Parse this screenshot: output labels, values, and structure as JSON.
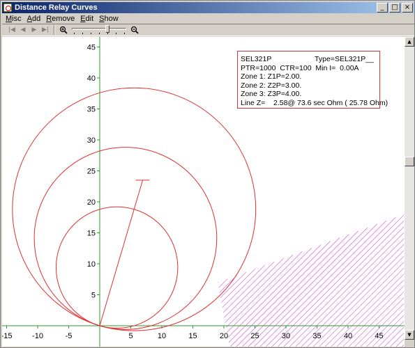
{
  "window": {
    "title": "Distance Relay Curves"
  },
  "caption_buttons": {
    "minimize": "_",
    "maximize": "□",
    "close": "×"
  },
  "menu": [
    {
      "u": "M",
      "rest": "isc"
    },
    {
      "u": "A",
      "rest": "dd"
    },
    {
      "u": "R",
      "rest": "emove"
    },
    {
      "u": "E",
      "rest": "dit"
    },
    {
      "u": "S",
      "rest": "how"
    }
  ],
  "toolbar": {
    "first_icon": "|◀",
    "prev_icon": "◀",
    "next_icon": "▶",
    "last_icon": "▶|",
    "zoom_in_icon": "+",
    "zoom_out_icon": "−",
    "zoom_level": 0.66
  },
  "plot": {
    "x_ticks": [
      "-15",
      "-10",
      "-5",
      "5",
      "10",
      "15",
      "20",
      "25",
      "30",
      "35",
      "40",
      "45"
    ],
    "y_ticks": [
      "45",
      "40",
      "35",
      "30",
      "25",
      "20",
      "15",
      "10",
      "5"
    ],
    "x_range": [
      -15,
      47
    ],
    "y_range": [
      -2.5,
      47
    ],
    "zone_color": "#e03030",
    "axis_color": "#2a9a2a",
    "hatch_color": "#cc33cc",
    "zone_diameters": [
      2.0,
      3.0,
      4.0
    ],
    "mho_angle_deg": 73.6,
    "line_reach": 25.78,
    "secondary_ohm_scale": 9.8
  },
  "info": {
    "relay": "SEL321P",
    "type": "Type=SEL321P__",
    "ratios": "PTR=1000  CTR=100  Min I=  0.00A",
    "zone1": "Zone 1: Z1P=2.00.",
    "zone2": "Zone 2: Z2P=3.00.",
    "zone3": "Zone 3: Z3P=4.00.",
    "line_z": "Line Z=    2.58@ 73.6 sec Ohm ( 25.78 Ohm)"
  }
}
